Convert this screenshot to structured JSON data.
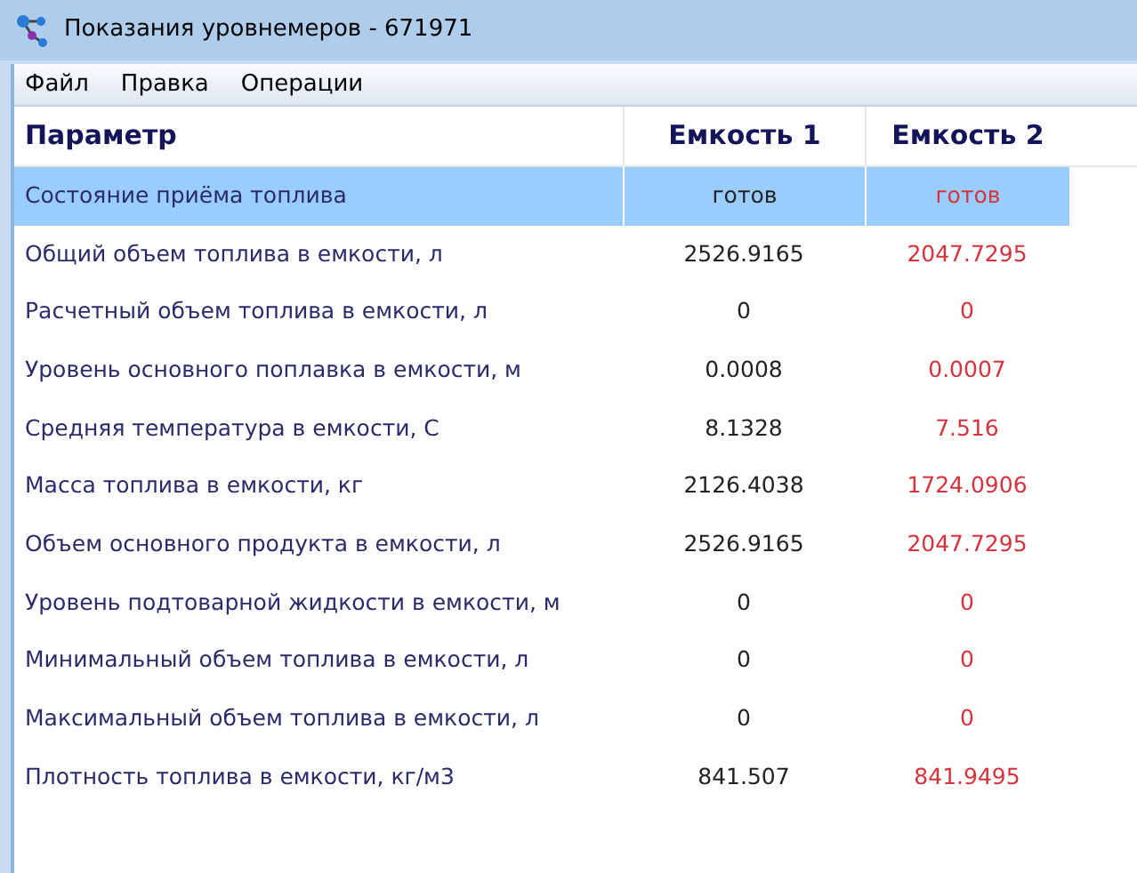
{
  "window": {
    "title": "Показания уровнемеров - 671971"
  },
  "menu": [
    "Файл",
    "Правка",
    "Операции"
  ],
  "table": {
    "columns": [
      {
        "label": "Параметр"
      },
      {
        "label": "Емкость 1"
      },
      {
        "label": "Емкость 2"
      }
    ],
    "rows": [
      {
        "cells": [
          "Состояние приёма топлива",
          "готов",
          "готов"
        ],
        "selected": true
      },
      {
        "cells": [
          "Общий объем топлива в емкости, л",
          "2526.9165",
          "2047.7295"
        ],
        "selected": false
      },
      {
        "cells": [
          "Расчетный объем топлива в емкости, л",
          "0",
          "0"
        ],
        "selected": false
      },
      {
        "cells": [
          "Уровень основного поплавка в емкости, м",
          "0.0008",
          "0.0007"
        ],
        "selected": false
      },
      {
        "cells": [
          "Средняя температура в емкости, С",
          "8.1328",
          "7.516"
        ],
        "selected": false
      },
      {
        "cells": [
          "Масса топлива в емкости, кг",
          "2126.4038",
          "1724.0906"
        ],
        "selected": false
      },
      {
        "cells": [
          "Объем основного продукта в емкости, л",
          "2526.9165",
          "2047.7295"
        ],
        "selected": false
      },
      {
        "cells": [
          "Уровень подтоварной жидкости в емкости, м",
          "0",
          "0"
        ],
        "selected": false
      },
      {
        "cells": [
          "Минимальный объем топлива в емкости, л",
          "0",
          "0"
        ],
        "selected": false
      },
      {
        "cells": [
          "Максимальный объем топлива в емкости, л",
          "0",
          "0"
        ],
        "selected": false
      },
      {
        "cells": [
          "Плотность топлива в емкости, кг/м3",
          "841.507",
          "841.9495"
        ],
        "selected": false
      }
    ]
  }
}
